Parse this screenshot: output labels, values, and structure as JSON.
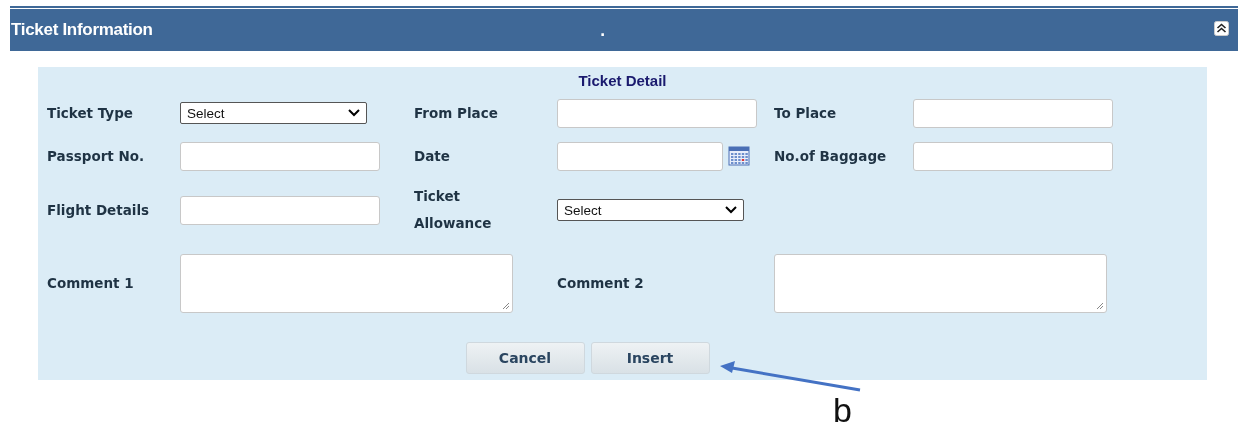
{
  "header": {
    "title": "Ticket Information",
    "center_text": "."
  },
  "panel": {
    "title": "Ticket Detail",
    "rows": [
      {
        "kind": "grid",
        "items": [
          {
            "label": "Ticket Type",
            "field": {
              "kind": "select",
              "value": "Select"
            }
          },
          {
            "label": "From Place",
            "field": {
              "kind": "text"
            }
          },
          {
            "label": "To Place",
            "field": {
              "kind": "text"
            }
          }
        ]
      },
      {
        "kind": "grid",
        "items": [
          {
            "label": "Passport No.",
            "field": {
              "kind": "text"
            }
          },
          {
            "label": "Date",
            "field": {
              "kind": "date"
            }
          },
          {
            "label": "No.of Baggage",
            "field": {
              "kind": "text"
            }
          }
        ]
      },
      {
        "kind": "grid",
        "items": [
          {
            "label": "Flight Details",
            "field": {
              "kind": "text"
            }
          },
          {
            "label": "Ticket Allowance",
            "field": {
              "kind": "select",
              "value": "Select"
            }
          }
        ]
      },
      {
        "kind": "wide",
        "items": [
          {
            "label": "Comment 1",
            "field": {
              "kind": "textarea"
            }
          },
          {
            "label": "Comment 2",
            "field": {
              "kind": "textarea"
            }
          }
        ]
      }
    ],
    "buttons": [
      "Cancel",
      "Insert"
    ]
  },
  "annotation": {
    "label": "b"
  }
}
